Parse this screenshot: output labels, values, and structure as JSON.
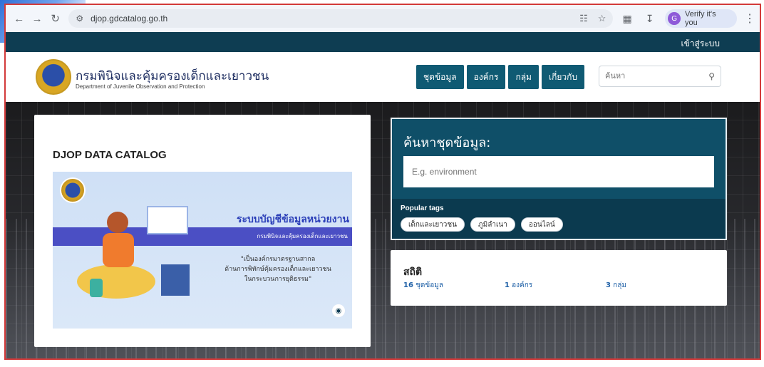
{
  "browser": {
    "url": "djop.gdcatalog.go.th",
    "profile_label": "Verify it's you",
    "profile_initial": "G"
  },
  "topbar": {
    "login_link": "เข้าสู่ระบบ"
  },
  "header": {
    "org_name_th": "กรมพินิจและคุ้มครองเด็กและเยาวชน",
    "org_name_en": "Department of Juvenile Observation and Protection",
    "nav": [
      {
        "label": "ชุดข้อมูล"
      },
      {
        "label": "องค์กร"
      },
      {
        "label": "กลุ่ม"
      },
      {
        "label": "เกี่ยวกับ"
      }
    ],
    "search_placeholder": "ค้นหา"
  },
  "catalog_card": {
    "title": "DJOP DATA CATALOG",
    "banner": {
      "headline": "ระบบบัญชีข้อมูลหน่วยงาน",
      "subline": "กรมพินิจและคุ้มครองเด็กและเยาวชน",
      "quote_line1": "\"เป็นองค์กรมาตรฐานสากล",
      "quote_line2": "ด้านการพิทักษ์คุ้มครองเด็กและเยาวชน",
      "quote_line3": "ในกระบวนการยุติธรรม\""
    }
  },
  "search_panel": {
    "title": "ค้นหาชุดข้อมูล:",
    "placeholder": "E.g. environment",
    "popular_label": "Popular tags",
    "tags": [
      "เด็กและเยาวชน",
      "ภูมิลำเนา",
      "ออนไลน์"
    ]
  },
  "stats": {
    "title": "สถิติ",
    "items": [
      {
        "count": "16",
        "label": "ชุดข้อมูล"
      },
      {
        "count": "1",
        "label": "องค์กร"
      },
      {
        "count": "3",
        "label": "กลุ่ม"
      }
    ]
  }
}
